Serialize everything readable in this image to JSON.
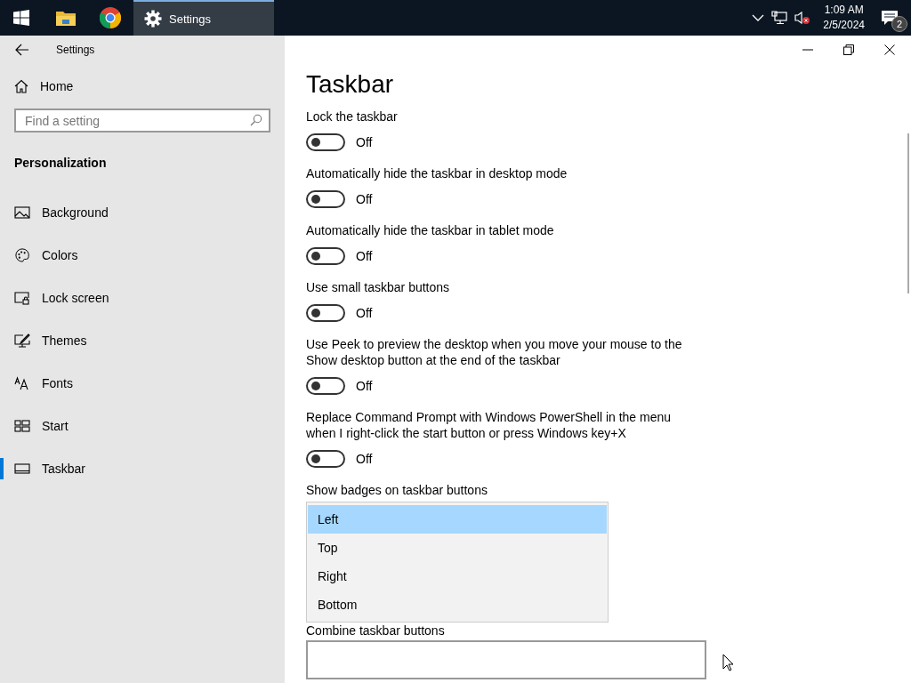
{
  "taskbar": {
    "apps": [
      {
        "kind": "start"
      },
      {
        "kind": "explorer"
      },
      {
        "kind": "chrome"
      },
      {
        "kind": "settings",
        "label": "Settings",
        "selected": true
      }
    ],
    "clock": {
      "time": "1:09 AM",
      "date": "2/5/2024"
    },
    "notification_count": "2"
  },
  "window": {
    "title": "Settings"
  },
  "sidebar": {
    "home": "Home",
    "search": {
      "placeholder": "Find a setting"
    },
    "section": "Personalization",
    "items": [
      {
        "label": "Background",
        "kind": "background",
        "selected": false
      },
      {
        "label": "Colors",
        "kind": "colors",
        "selected": false
      },
      {
        "label": "Lock screen",
        "kind": "lock",
        "selected": false
      },
      {
        "label": "Themes",
        "kind": "themes",
        "selected": false
      },
      {
        "label": "Fonts",
        "kind": "fonts",
        "selected": false
      },
      {
        "label": "Start",
        "kind": "start",
        "selected": false
      },
      {
        "label": "Taskbar",
        "kind": "taskbar",
        "selected": true
      }
    ]
  },
  "page": {
    "title": "Taskbar",
    "settings": [
      {
        "label": "Lock the taskbar",
        "on": false,
        "state": "Off"
      },
      {
        "label": "Automatically hide the taskbar in desktop mode",
        "on": false,
        "state": "Off"
      },
      {
        "label": "Automatically hide the taskbar in tablet mode",
        "on": false,
        "state": "Off"
      },
      {
        "label": "Use small taskbar buttons",
        "on": false,
        "state": "Off"
      },
      {
        "label": "Use Peek to preview the desktop when you move your mouse to the Show desktop button at the end of the taskbar",
        "on": false,
        "state": "Off"
      },
      {
        "label": "Replace Command Prompt with Windows PowerShell in the menu when I right-click the start button or press Windows key+X",
        "on": false,
        "state": "Off"
      }
    ],
    "badges_label": "Show badges on taskbar buttons",
    "dropdown": [
      {
        "label": "Left",
        "selected": true
      },
      {
        "label": "Top",
        "selected": false
      },
      {
        "label": "Right",
        "selected": false
      },
      {
        "label": "Bottom",
        "selected": false
      }
    ],
    "combine_label": "Combine taskbar buttons"
  }
}
